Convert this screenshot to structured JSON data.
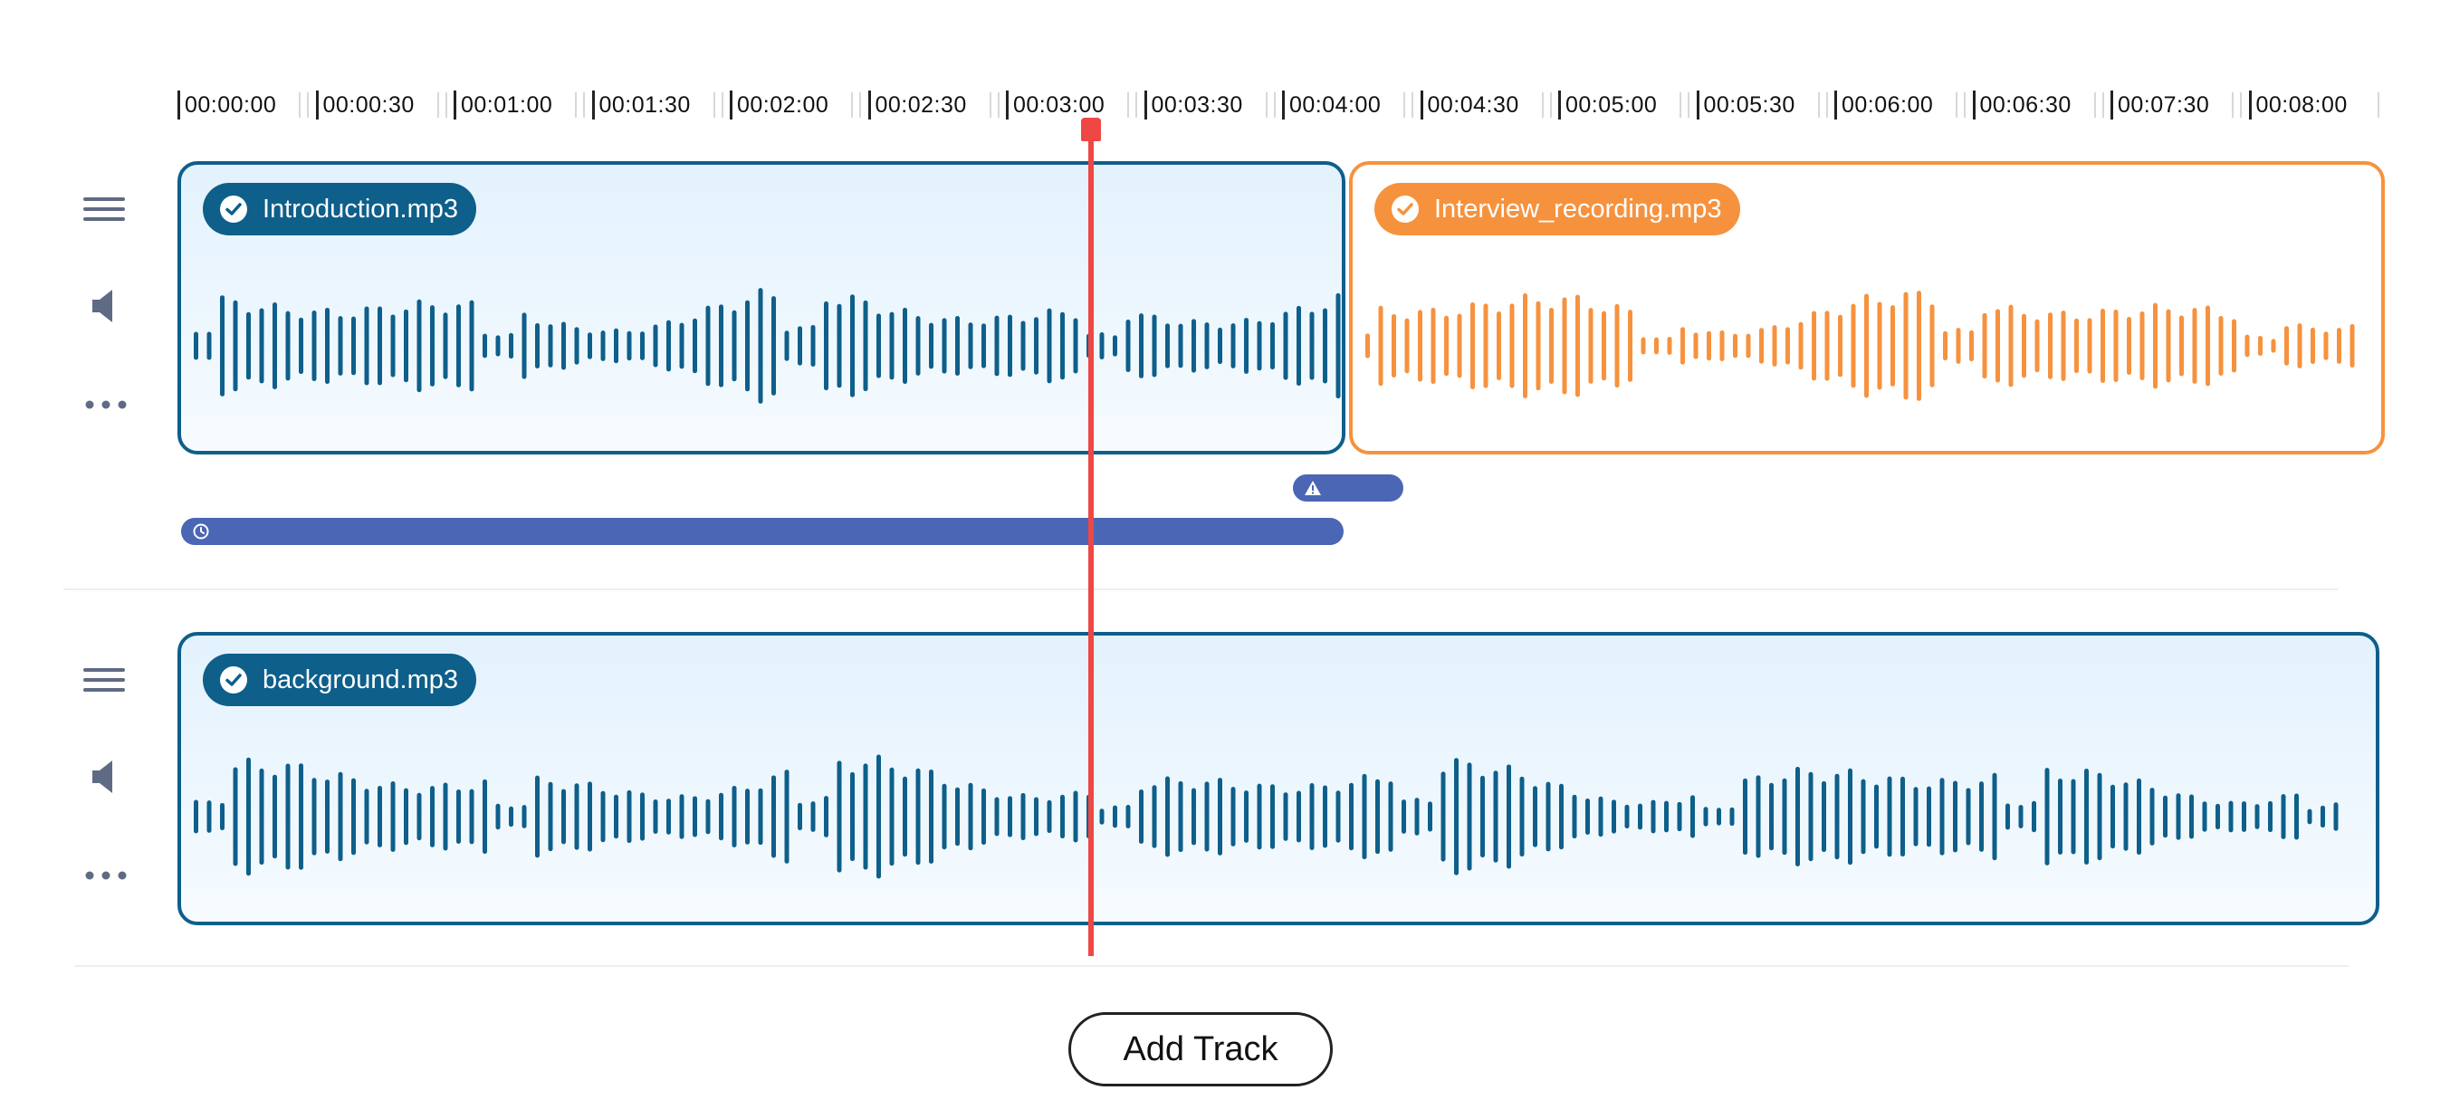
{
  "timeline": {
    "ticks": [
      "00:00:00",
      "00:00:30",
      "00:01:00",
      "00:01:30",
      "00:02:00",
      "00:02:30",
      "00:03:00",
      "00:03:30",
      "00:04:00",
      "00:04:30",
      "00:05:00",
      "00:05:30",
      "00:06:00",
      "00:06:30",
      "00:07:30",
      "00:08:00"
    ],
    "playhead_time": "00:03:00"
  },
  "tracks": [
    {
      "controls": {
        "menu_icon": "hamburger-menu-icon",
        "volume_icon": "speaker-icon",
        "more_icon": "more-dots-icon"
      },
      "clips": [
        {
          "name": "Introduction.mp3",
          "status_icon": "check-circle-icon",
          "color": "#0e5f8a"
        },
        {
          "name": "Interview_recording.mp3",
          "status_icon": "check-circle-icon",
          "color": "#f6923e"
        }
      ],
      "markers": [
        {
          "icon": "warning-triangle-icon",
          "color": "#4a66b4"
        },
        {
          "icon": "timer-icon",
          "color": "#4a66b4"
        }
      ]
    },
    {
      "controls": {
        "menu_icon": "hamburger-menu-icon",
        "volume_icon": "speaker-icon",
        "more_icon": "more-dots-icon"
      },
      "clips": [
        {
          "name": "background.mp3",
          "status_icon": "check-circle-icon",
          "color": "#0e5f8a"
        }
      ]
    }
  ],
  "add_track_label": "Add Track",
  "colors": {
    "accent_blue": "#0e5f8a",
    "accent_orange": "#f6923e",
    "playhead": "#ee4744",
    "marker": "#4a66b4"
  }
}
